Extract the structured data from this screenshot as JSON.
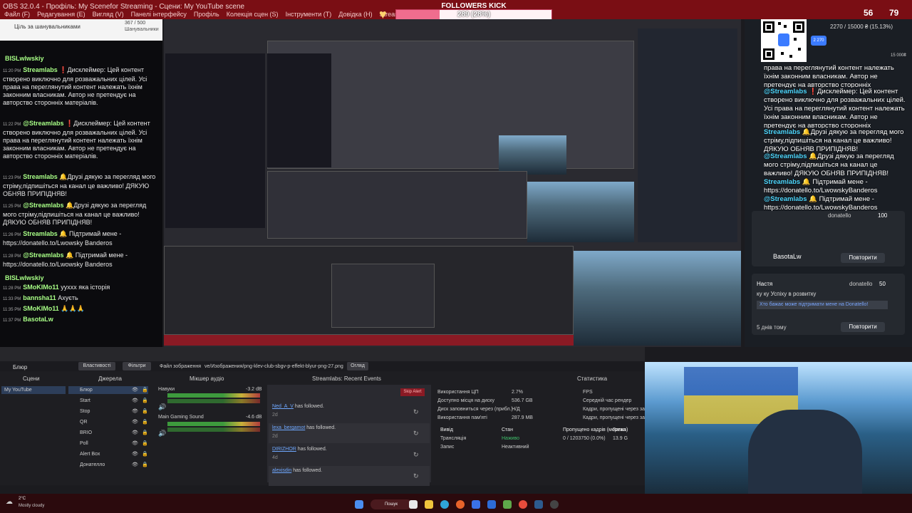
{
  "window": {
    "title": "OBS 32.0.4 - Профіль: My Scenefor Streaming - Сцени: My YouTube scene"
  },
  "menubar": [
    "Файл (F)",
    "Редагування (E)",
    "Вигляд (V)",
    "Панелі інтерфейсу",
    "Профіль",
    "Колекція сцен (S)",
    "Інструменти (T)",
    "Довідка (H)",
    "Streamlabs"
  ],
  "goal": {
    "title": "FOLLOWERS KICK",
    "value": "289 (28%)",
    "progress": 0.28,
    "min": "0",
    "max": "1000"
  },
  "top_stats": {
    "a": "56",
    "b": "79"
  },
  "left_chat": {
    "header": {
      "title": "Ціль за шанувальниками",
      "count": "367 / 500",
      "sub": "Шанувальники"
    },
    "lines": [
      {
        "time": "",
        "name": "BISLwlwskiy",
        "text": ""
      },
      {
        "time": "11:20 PM",
        "name": "Streamlabs",
        "text": "❗Дисклеймер: Цей контент створено виключно для розважальних цілей. Усі права на переглянутий контент належать їхнім законним власникам. Автор не претендує на авторство сторонніх матеріалів."
      },
      {
        "time": "11:22 PM",
        "name": "@Streamlabs",
        "text": "❗Дисклеймер: Цей контент створено виключно для розважальних цілей. Усі права на переглянутий контент належать їхнім законним власникам. Автор не претендує на авторство сторонніх матеріалів."
      },
      {
        "time": "11:23 PM",
        "name": "Streamlabs",
        "text": "🔔Друзі дякую за перегляд мого стріму,підпишіться на канал це важливо! ДЯКУЮ ОБНЯВ ПРИПІДНЯВ!"
      },
      {
        "time": "11:25 PM",
        "name": "@Streamlabs",
        "text": "🔔Друзі дякую за перегляд мого стріму,підпишіться на канал це важливо!ДЯКУЮ ОБНЯВ ПРИПІДНЯВ!"
      },
      {
        "time": "11:26 PM",
        "name": "Streamlabs",
        "text": "🔔 Підтримай мене - https://donatello.to/Lwowsky Banderos"
      },
      {
        "time": "11:28 PM",
        "name": "@Streamlabs",
        "text": "🔔 Підтримай мене - https://donatello.to/Lwowsky Banderos"
      },
      {
        "time": "",
        "name": "BISLwlwskiy",
        "text": ""
      },
      {
        "time": "11:28 PM",
        "name": "SMoKIMo11",
        "text": "ууххх яка історія"
      },
      {
        "time": "11:33 PM",
        "name": "bannsha11",
        "text": "Ахуєть"
      },
      {
        "time": "11:35 PM",
        "name": "SMoKIMo11",
        "text": "🙏🙏🙏"
      },
      {
        "time": "11:37 PM",
        "name": "BasotaLw",
        "text": ""
      }
    ]
  },
  "right_chat": {
    "qr": {
      "progress_text": "2270 / 15000 ₴ (15.13%)",
      "badge": "2 270",
      "balance": "15 000₴"
    },
    "lines": [
      {
        "name": "",
        "text": "права на переглянутий контент належать їхнім законним власникам. Автор не претендує на авторство сторонніх матеріалів."
      },
      {
        "name": "@Streamlabs",
        "text": "❗Дисклеймер: Цей контент створено виключно для розважальних цілей. Усі права на переглянутий контент належать їхнім законним власникам. Автор не претендує на авторство сторонніх матеріалів."
      },
      {
        "name": "Streamlabs",
        "text": "🔔Друзі дякую за перегляд мого стріму,підпишіться на канал це важливо! ДЯКУЮ ОБНЯВ ПРИПІДНЯВ!"
      },
      {
        "name": "@Streamlabs",
        "text": "🔔Друзі дякую за перегляд мого стріму,підпишіться на канал це важливо! ДЯКУЮ ОБНЯВ ПРИПІДНЯВ!"
      },
      {
        "name": "Streamlabs",
        "text": "🔔 Підтримай мене - https://donatello.to/LwowskyBanderos"
      },
      {
        "name": "@Streamlabs",
        "text": "🔔 Підтримай мене - https://donatello.to/LwowskyBanderos"
      },
      {
        "name": "BISLwlwskiy",
        "text": ""
      },
      {
        "name": "SMoKIMo11",
        "text": "ууххх яка історія"
      }
    ],
    "donation1": {
      "label": "donatello",
      "amount": "100",
      "button": "Повторити"
    },
    "donation2": {
      "name": "Настя",
      "label": "donatello",
      "amount": "50",
      "text": "ку ку Успіху в розвитку",
      "sub": "Хто бажає може підтримати мене на Donatello!",
      "age": "5 днів тому",
      "button": "Повторити"
    },
    "last_name": "BasotaLw"
  },
  "obs": {
    "toolbar": {
      "source": "Блюр",
      "props": "Властивості",
      "filters": "Фільтри",
      "file": "Файл зображення",
      "path": "ve/Изображения/png-klev-club-sbgv-p-effekt-blyur-png-27.png",
      "browse": "Огляд"
    },
    "docks": {
      "scenes": "Сцени",
      "sources": "Джерела",
      "mixer": "Мікшер аудіо",
      "events": "Streamlabs: Recent Events",
      "stats": "Статистика"
    },
    "scenes": [
      "My YouTube"
    ],
    "sources": [
      "Блюр",
      "Start",
      "Stop",
      "QR",
      "BRIO",
      "Poll",
      "Alert Box",
      "Донателло"
    ],
    "mixer": [
      {
        "name": "Навуки",
        "db": "-3.2 dB"
      },
      {
        "name": "Main Gaming Sound",
        "db": "-4.6 dB"
      }
    ],
    "events": {
      "skip": "Skip Alert",
      "items": [
        {
          "name": "Ned_A_V",
          "text": "has followed.",
          "age": "2d"
        },
        {
          "name": "lexa_bergamot",
          "text": "has followed.",
          "age": "2d"
        },
        {
          "name": "DIRIZHOR",
          "text": "has followed.",
          "age": "4d"
        },
        {
          "name": "alexisdin",
          "text": "has followed.",
          "age": ""
        }
      ]
    },
    "stats": {
      "rows": [
        {
          "label": "Використання ЦП",
          "value": "2.7%"
        },
        {
          "label": "Доступно місця на диску",
          "value": "536.7 GB"
        },
        {
          "label": "Диск заповниться через (прибл.)",
          "value": "Н/Д"
        },
        {
          "label": "Використання пам'яті",
          "value": "287.9 MB"
        }
      ],
      "right": [
        "FPS",
        "Середній час рендер",
        "Кадри, пропущені через затр",
        "Кадри, пропущені через затр"
      ],
      "table_head": [
        "Вивід",
        "Стан",
        "Пропущено кадрів (мережа)",
        "Загал"
      ],
      "table_rows": [
        {
          "out": "Трансляція",
          "state": "Наживо",
          "dropped": "0 / 1203750 (0.0%)",
          "total": "13.9 G"
        },
        {
          "out": "Запис",
          "state": "Неактивний",
          "dropped": "",
          "total": ""
        }
      ]
    }
  },
  "taskbar": {
    "weather_temp": "2°C",
    "weather_desc": "Mostly cloudy",
    "search": "Пошук"
  },
  "colors": {
    "accent_red": "#7a0e14",
    "chat_name": "#a8ff86",
    "link": "#6fa8ff",
    "goal_fill": "#f06d8e"
  }
}
